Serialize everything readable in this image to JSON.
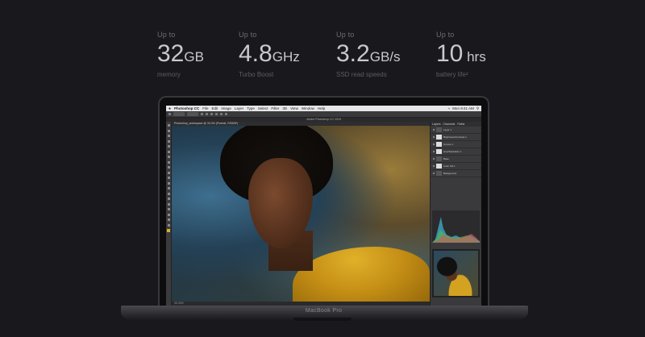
{
  "specs": [
    {
      "upto": "Up to",
      "value": "32",
      "unit": "GB",
      "caption": "memory"
    },
    {
      "upto": "Up to",
      "value": "4.8",
      "unit": "GHz",
      "caption": "Turbo Boost"
    },
    {
      "upto": "Up to",
      "value": "3.2",
      "unit": "GB/s",
      "caption": "SSD read speeds"
    },
    {
      "upto": "Up to",
      "value": "10",
      "unit": " hrs",
      "caption": "battery life²"
    }
  ],
  "laptop": {
    "brand": "MacBook Pro",
    "menubar": {
      "apple": "",
      "app": "Photoshop CC",
      "items": [
        "File",
        "Edit",
        "Image",
        "Layer",
        "Type",
        "Select",
        "Filter",
        "3D",
        "View",
        "Window",
        "Help"
      ],
      "clock": "Mon 9:41 AM"
    },
    "window_title": "Adobe Photoshop CC 2018",
    "doc_tab": "Photoshop_workspace @ 33.3% (Portrait, RGB/8*)",
    "doc_status": "33.33%",
    "panel_tabs": [
      "Layers",
      "Channels",
      "Paths"
    ],
    "layers": [
      "Layer 1",
      "Brightness/Contrast 1",
      "Curves 1",
      "Hue/Saturation 1",
      "Base",
      "Color Fill 1",
      "Background"
    ]
  },
  "colors": {
    "background": "#19181d",
    "spec_value": "#c9c8cd",
    "shirt": "#c48e15"
  }
}
